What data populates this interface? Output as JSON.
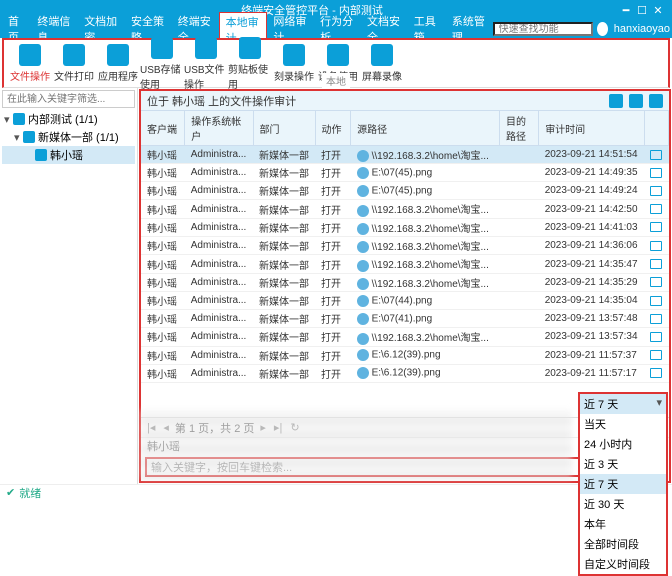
{
  "window": {
    "title": "终端安全管控平台 - 内部测试"
  },
  "menus": [
    "首页",
    "终端信息",
    "文档加密",
    "安全策略",
    "终端安全",
    "本地审计",
    "网络审计",
    "行为分析",
    "文档安全",
    "工具箱",
    "系统管理"
  ],
  "menu_active": "本地审计",
  "search_placeholder": "快速查找功能",
  "user": "hanxiaoyao",
  "ribbon": [
    {
      "label": "文件操作",
      "hl": true
    },
    {
      "label": "文件打印"
    },
    {
      "label": "应用程序"
    },
    {
      "label": "USB存储使用"
    },
    {
      "label": "USB文件操作"
    },
    {
      "label": "剪贴板使用"
    },
    {
      "label": "刻录操作"
    },
    {
      "label": "设备使用"
    },
    {
      "label": "屏幕录像"
    }
  ],
  "ribbon_section": "本地",
  "sidebar": {
    "filter_placeholder": "在此输入关键字筛选...",
    "nodes": [
      {
        "label": "内部测试 (1/1)",
        "depth": 0,
        "exp": "▾"
      },
      {
        "label": "新媒体一部 (1/1)",
        "depth": 1,
        "exp": "▾"
      },
      {
        "label": "韩小瑶",
        "depth": 2,
        "sel": true
      }
    ]
  },
  "pathbar": "位于 韩小瑶 上的文件操作审计",
  "columns": [
    "客户端",
    "操作系统帐户",
    "部门",
    "动作",
    "源路径",
    "目的路径",
    "审计时间",
    ""
  ],
  "rows": [
    {
      "c": "韩小瑶",
      "s": "Administra...",
      "d": "新媒体一部",
      "a": "打开",
      "p": "\\\\192.168.3.2\\home\\淘宝...",
      "t": "2023-09-21 14:51:54",
      "sel": true
    },
    {
      "c": "韩小瑶",
      "s": "Administra...",
      "d": "新媒体一部",
      "a": "打开",
      "p": "E:\\07(45).png",
      "t": "2023-09-21 14:49:35"
    },
    {
      "c": "韩小瑶",
      "s": "Administra...",
      "d": "新媒体一部",
      "a": "打开",
      "p": "E:\\07(45).png",
      "t": "2023-09-21 14:49:24"
    },
    {
      "c": "韩小瑶",
      "s": "Administra...",
      "d": "新媒体一部",
      "a": "打开",
      "p": "\\\\192.168.3.2\\home\\淘宝...",
      "t": "2023-09-21 14:42:50"
    },
    {
      "c": "韩小瑶",
      "s": "Administra...",
      "d": "新媒体一部",
      "a": "打开",
      "p": "\\\\192.168.3.2\\home\\淘宝...",
      "t": "2023-09-21 14:41:03"
    },
    {
      "c": "韩小瑶",
      "s": "Administra...",
      "d": "新媒体一部",
      "a": "打开",
      "p": "\\\\192.168.3.2\\home\\淘宝...",
      "t": "2023-09-21 14:36:06"
    },
    {
      "c": "韩小瑶",
      "s": "Administra...",
      "d": "新媒体一部",
      "a": "打开",
      "p": "\\\\192.168.3.2\\home\\淘宝...",
      "t": "2023-09-21 14:35:47"
    },
    {
      "c": "韩小瑶",
      "s": "Administra...",
      "d": "新媒体一部",
      "a": "打开",
      "p": "\\\\192.168.3.2\\home\\淘宝...",
      "t": "2023-09-21 14:35:29"
    },
    {
      "c": "韩小瑶",
      "s": "Administra...",
      "d": "新媒体一部",
      "a": "打开",
      "p": "E:\\07(44).png",
      "t": "2023-09-21 14:35:04"
    },
    {
      "c": "韩小瑶",
      "s": "Administra...",
      "d": "新媒体一部",
      "a": "打开",
      "p": "E:\\07(41).png",
      "t": "2023-09-21 13:57:48"
    },
    {
      "c": "韩小瑶",
      "s": "Administra...",
      "d": "新媒体一部",
      "a": "打开",
      "p": "\\\\192.168.3.2\\home\\淘宝...",
      "t": "2023-09-21 13:57:34"
    },
    {
      "c": "韩小瑶",
      "s": "Administra...",
      "d": "新媒体一部",
      "a": "打开",
      "p": "E:\\6.12(39).png",
      "t": "2023-09-21 11:57:37"
    },
    {
      "c": "韩小瑶",
      "s": "Administra...",
      "d": "新媒体一部",
      "a": "打开",
      "p": "E:\\6.12(39).png",
      "t": "2023-09-21 11:57:17"
    }
  ],
  "pager": {
    "text": "第 1 页，共 2 页",
    "btns": [
      "|◂",
      "◂",
      "▸",
      "▸|",
      "↻"
    ]
  },
  "crumb": "韩小瑶",
  "search_hint": "输入关键字，按回车键检索...",
  "dropdown": {
    "header": "近 7 天",
    "items": [
      "当天",
      "24 小时内",
      "近 3 天",
      "近 7 天",
      "近 30 天",
      "本年",
      "全部时间段",
      "自定义时间段"
    ],
    "sel": "近 7 天"
  },
  "status": "就绪"
}
